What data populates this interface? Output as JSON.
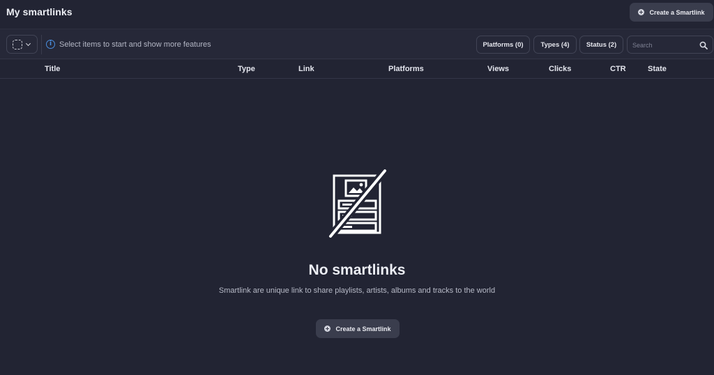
{
  "header": {
    "title": "My smartlinks",
    "create_button_label": "Create a Smartlink"
  },
  "toolbar": {
    "select_hint": "Select items to start and show more features",
    "filters": {
      "platforms": "Platforms (0)",
      "types": "Types (4)",
      "status": "Status (2)"
    },
    "search_placeholder": "Search"
  },
  "table": {
    "columns": {
      "title": "Title",
      "type": "Type",
      "link": "Link",
      "platforms": "Platforms",
      "views": "Views",
      "clicks": "Clicks",
      "ctr": "CTR",
      "state": "State"
    },
    "rows": []
  },
  "empty_state": {
    "icon": "no-smartlinks-illustration",
    "title": "No smartlinks",
    "description": "Smartlink are unique link to share playlists, artists, albums and tracks to the world",
    "button_label": "Create a Smartlink"
  },
  "colors": {
    "background": "#222433",
    "toolbar": "#262838",
    "button": "#3a3d4d",
    "accent_info": "#4a8fe0",
    "text": "#e6e7ee"
  }
}
